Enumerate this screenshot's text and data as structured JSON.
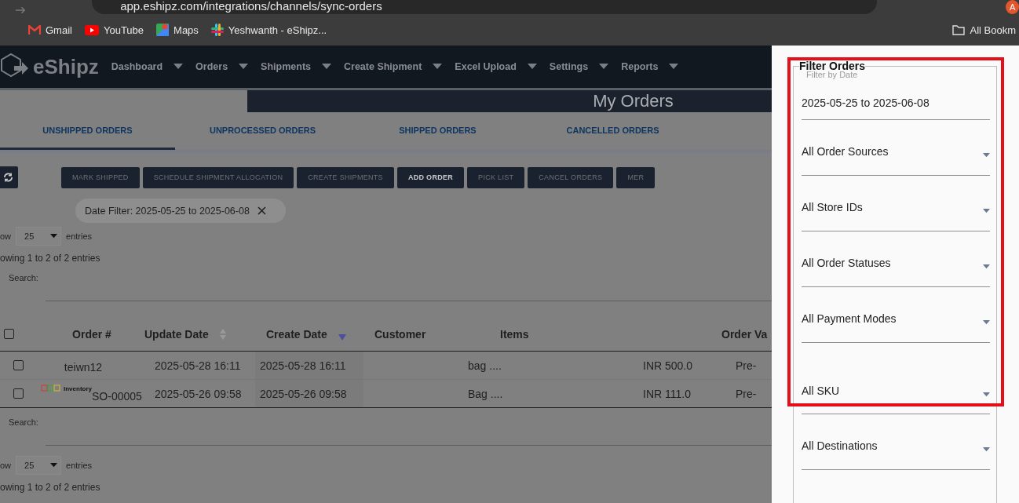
{
  "browser": {
    "url": "app.eshipz.com/integrations/channels/sync-orders",
    "bookmarks": [
      {
        "label": "Gmail",
        "kind": "mail"
      },
      {
        "label": "YouTube",
        "kind": "video"
      },
      {
        "label": "Maps",
        "kind": "pin"
      },
      {
        "label": "Yeshwanth - eShipz...",
        "kind": "hash"
      }
    ],
    "all_bookmarks": "All Bookm",
    "avatar": "A"
  },
  "app": {
    "logo": "eShipz",
    "nav": [
      "Dashboard",
      "Orders",
      "Shipments",
      "Create Shipment",
      "Excel Upload",
      "Settings",
      "Reports"
    ]
  },
  "page_title": "My Orders",
  "tabs": [
    {
      "label": "UNSHIPPED ORDERS",
      "selected": true
    },
    {
      "label": "UNPROCESSED ORDERS",
      "selected": false
    },
    {
      "label": "SHIPPED ORDERS",
      "selected": false
    },
    {
      "label": "CANCELLED ORDERS",
      "selected": false
    }
  ],
  "actions": [
    {
      "label": "MARK SHIPPED",
      "disabled": true
    },
    {
      "label": "SCHEDULE SHIPMENT ALLOCATION",
      "disabled": true
    },
    {
      "label": "CREATE SHIPMENTS",
      "disabled": true
    },
    {
      "label": "ADD ORDER",
      "disabled": false
    },
    {
      "label": "PICK LIST",
      "disabled": true
    },
    {
      "label": "CANCEL ORDERS",
      "disabled": true
    },
    {
      "label": "MER",
      "disabled": true
    }
  ],
  "date_chip": "Date Filter: 2025-05-25 to 2025-06-08",
  "length_top": {
    "prefix": "ow",
    "value": "25",
    "suffix": "entries"
  },
  "info_top": "owing 1 to 2 of 2 entries",
  "search_top": "Search:",
  "table": {
    "select_all_checked": false,
    "columns": [
      {
        "label": "Order #"
      },
      {
        "label": "Update Date",
        "sortable": true,
        "sorted": false
      },
      {
        "label": "Create Date",
        "sortable": true,
        "sorted": true
      },
      {
        "label": "Customer"
      },
      {
        "label": "Items"
      },
      {},
      {
        "label": "Order Va"
      }
    ],
    "rows": [
      {
        "checked": false,
        "order": "teiwn12",
        "update": "2025-05-28 16:11",
        "create": "2025-05-28 16:11",
        "items": "bag ....",
        "value": "INR 500.0",
        "payment": "Pre-"
      },
      {
        "checked": false,
        "source": "Inventory",
        "order": "SO-00005",
        "update": "2025-05-26 09:58",
        "create": "2025-05-26 09:58",
        "items": "Bag ....",
        "value": "INR 111.0",
        "payment": "Pre-"
      }
    ]
  },
  "search_bottom": "Search:",
  "length_bottom": {
    "prefix": "ow",
    "value": "25",
    "suffix": "entries"
  },
  "info_bottom": "owing 1 to 2 of 2 entries",
  "drawer": {
    "title": "Filter Orders",
    "date_label": "Filter by Date",
    "date_value": "2025-05-25 to 2025-06-08",
    "selects": [
      "All Order Sources",
      "All Store IDs",
      "All Order Statuses",
      "All Payment Modes",
      "All SKU",
      "All Destinations"
    ]
  }
}
